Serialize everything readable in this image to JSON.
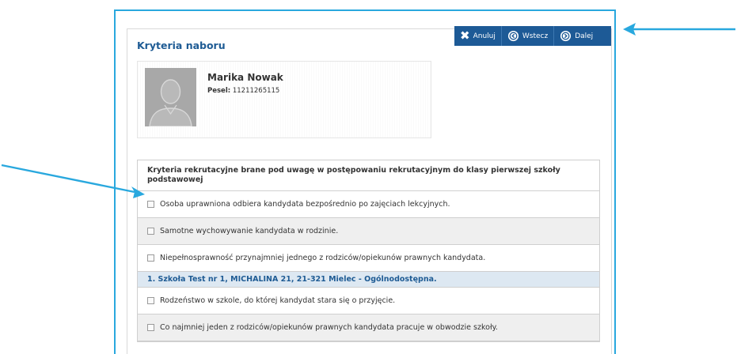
{
  "header": {
    "title": "Kryteria naboru"
  },
  "toolbar": {
    "cancel_label": "Anuluj",
    "back_label": "Wstecz",
    "next_label": "Dalej",
    "cancel_icon": "x-icon",
    "back_icon": "circle-left-icon",
    "next_icon": "circle-right-icon"
  },
  "candidate": {
    "name": "Marika Nowak",
    "pesel_label": "Pesel:",
    "pesel_value": "11211265115"
  },
  "criteria": {
    "header": "Kryteria rekrutacyjne brane pod uwagę w postępowaniu rekrutacyjnym do klasy pierwszej szkoły podstawowej",
    "items": [
      {
        "label": "Osoba uprawniona odbiera kandydata bezpośrednio po zajęciach lekcyjnych.",
        "checked": false
      },
      {
        "label": "Samotne wychowywanie kandydata w rodzinie.",
        "checked": false
      },
      {
        "label": "Niepełnosprawność przynajmniej jednego z rodziców/opiekunów prawnych kandydata.",
        "checked": false
      }
    ],
    "school": "1. Szkoła Test nr 1, MICHALINA 21, 21-321 Mielec - Ogólnodostępna.",
    "school_items": [
      {
        "label": "Rodzeństwo w szkole, do której kandydat stara się o przyjęcie.",
        "checked": false
      },
      {
        "label": "Co najmniej jeden z rodziców/opiekunów prawnych kandydata pracuje w obwodzie szkoły.",
        "checked": false
      }
    ]
  },
  "colors": {
    "accent": "#29a8de",
    "toolbar": "#1d5a96",
    "title": "#1e5b94"
  }
}
